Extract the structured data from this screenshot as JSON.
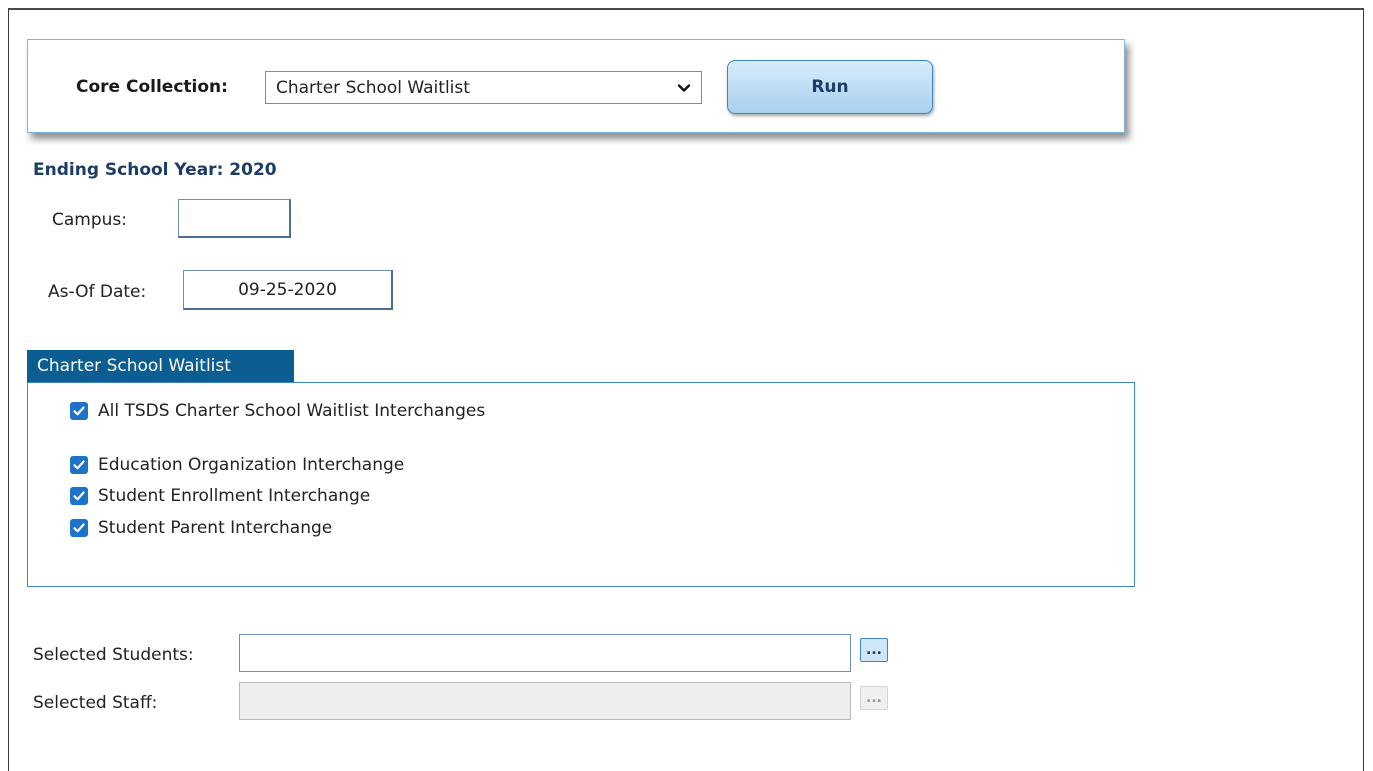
{
  "toolbar": {
    "core_collection_label": "Core Collection:",
    "core_collection_value": "Charter School Waitlist",
    "run_label": "Run"
  },
  "ending_year": "Ending School Year: 2020",
  "campus": {
    "label": "Campus:",
    "value": ""
  },
  "as_of_date": {
    "label": "As-Of Date:",
    "value": "09-25-2020"
  },
  "panel": {
    "title": "Charter School Waitlist",
    "all_item": {
      "label": "All TSDS Charter School Waitlist Interchanges",
      "checked": true
    },
    "items": [
      {
        "label": "Education Organization Interchange",
        "checked": true
      },
      {
        "label": "Student Enrollment Interchange",
        "checked": true
      },
      {
        "label": "Student Parent Interchange",
        "checked": true
      }
    ]
  },
  "selected_students": {
    "label": "Selected Students:",
    "value": "",
    "browse_label": "..."
  },
  "selected_staff": {
    "label": "Selected Staff:",
    "value": "",
    "browse_label": "...",
    "disabled": true
  },
  "colors": {
    "accent": "#0b5d92",
    "checkbox": "#1e73c8",
    "heading": "#1d3c66"
  }
}
